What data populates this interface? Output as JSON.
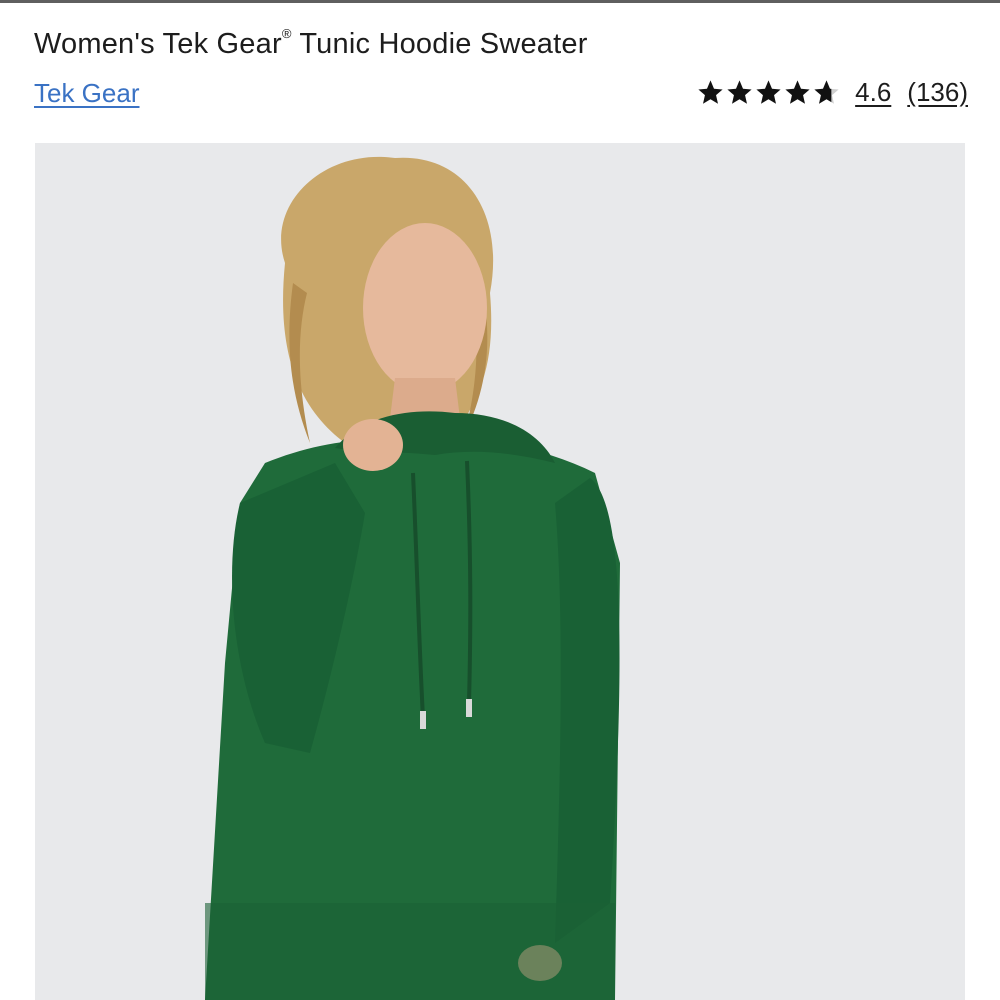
{
  "product": {
    "title_main": "Women's Tek Gear",
    "title_mark": "®",
    "title_rest": " Tunic Hoodie Sweater",
    "brand": "Tek Gear",
    "rating": {
      "value": "4.6",
      "count": "(136)",
      "stars_filled_fraction": 0.92
    }
  },
  "colors": {
    "link": "#3a72c4",
    "sweater_green": "#1f6b3a",
    "background": "#e7e8ea"
  },
  "icons": [
    "star-icon"
  ]
}
